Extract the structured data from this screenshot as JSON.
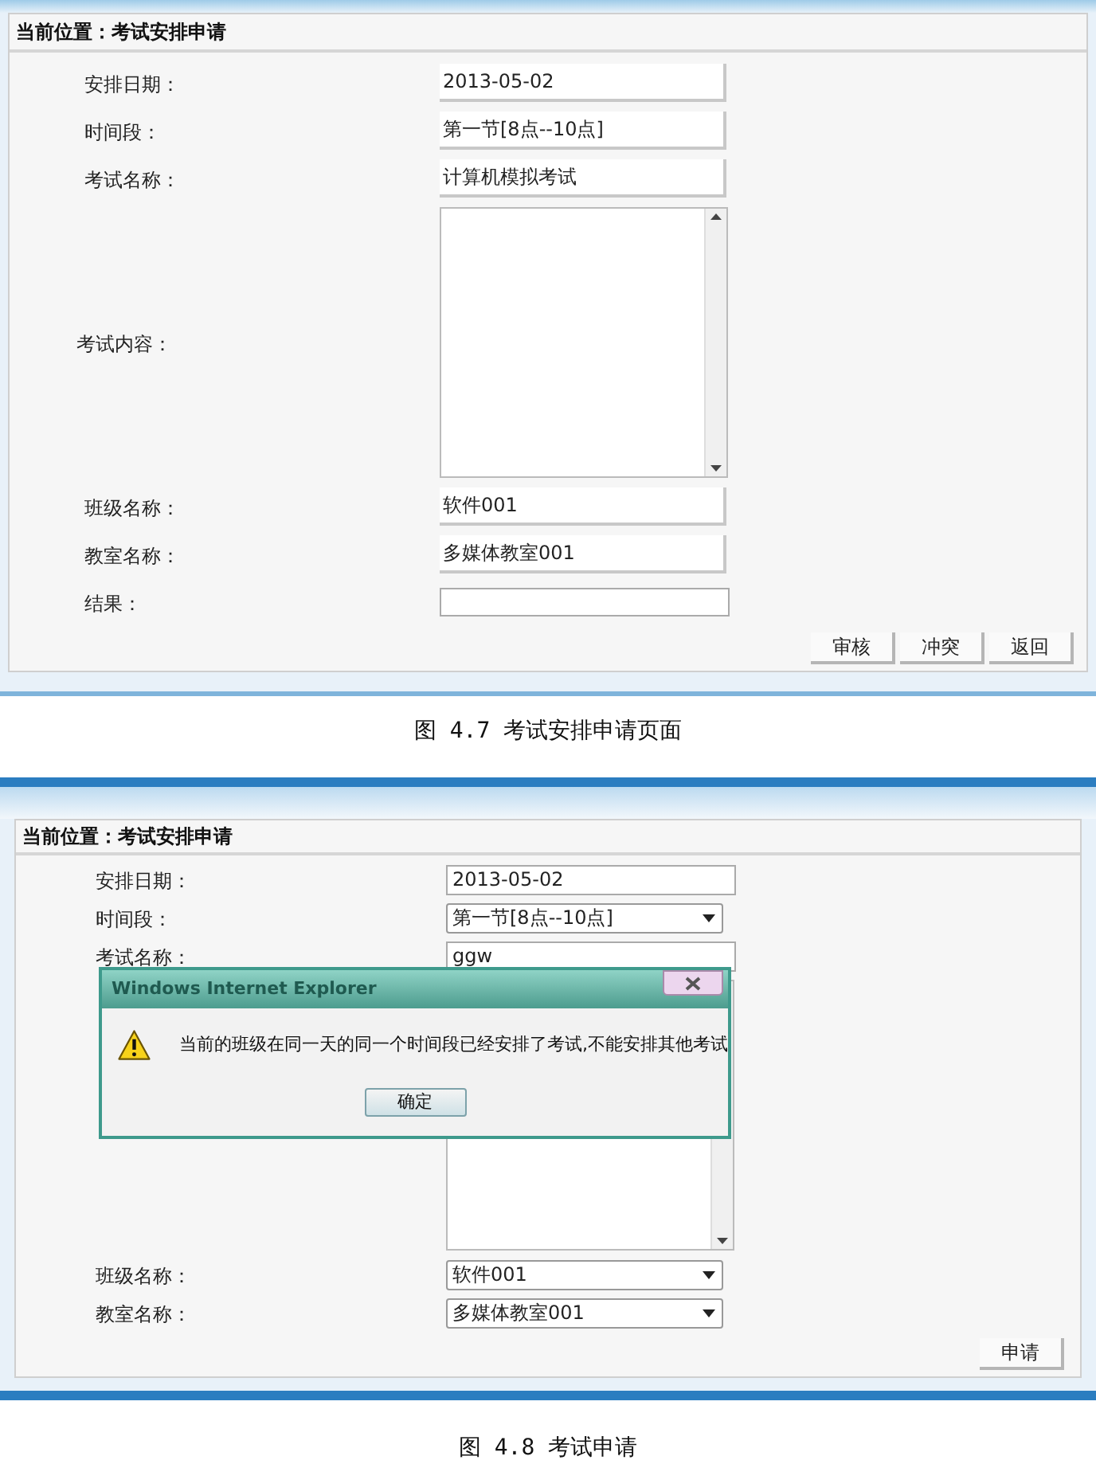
{
  "figures": [
    {
      "header": "当前位置：考试安排申请",
      "rows": [
        {
          "kind": "text",
          "label": "安排日期：",
          "value": "2013-05-02"
        },
        {
          "kind": "text",
          "label": "时间段：",
          "value": "第一节[8点--10点]"
        },
        {
          "kind": "text",
          "label": "考试名称：",
          "value": "计算机模拟考试"
        },
        {
          "kind": "textarea",
          "label": "考试内容："
        },
        {
          "kind": "text",
          "label": "班级名称：",
          "value": "软件001"
        },
        {
          "kind": "text",
          "label": "教室名称：",
          "value": "多媒体教室001"
        },
        {
          "kind": "input",
          "label": "结果："
        }
      ],
      "buttons": [
        "审核",
        "冲突",
        "返回"
      ],
      "caption": "图 4.7 考试安排申请页面"
    },
    {
      "header": "当前位置：考试安排申请",
      "rows": [
        {
          "kind": "input",
          "label": "安排日期：",
          "value": "2013-05-02"
        },
        {
          "kind": "select",
          "label": "时间段：",
          "value": "第一节[8点--10点]"
        },
        {
          "kind": "input",
          "label": "考试名称：",
          "value": "ggw"
        },
        {
          "kind": "textarea"
        },
        {
          "kind": "select",
          "label": "班级名称：",
          "value": "软件001"
        },
        {
          "kind": "select",
          "label": "教室名称：",
          "value": "多媒体教室001"
        }
      ],
      "buttons": [
        "申请"
      ],
      "dialog": {
        "title": "Windows Internet Explorer",
        "message": "当前的班级在同一天的同一个时间段已经安排了考试,不能安排其他考试",
        "button": "确定"
      },
      "caption": "图 4.8 考试申请"
    }
  ]
}
